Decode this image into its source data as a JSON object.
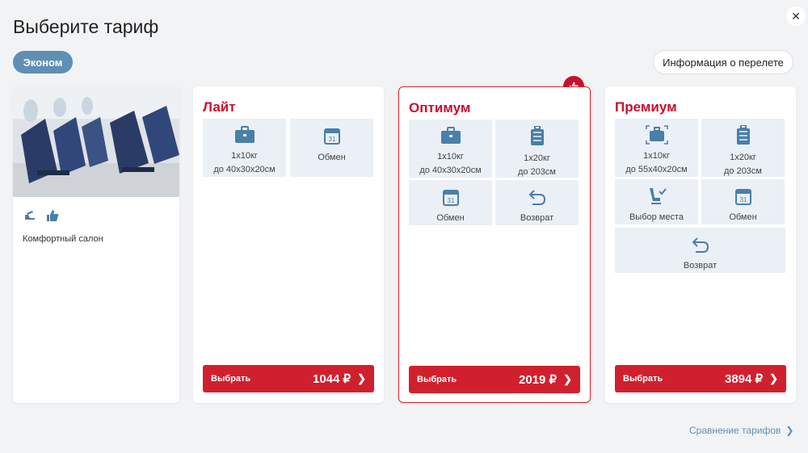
{
  "header": {
    "title": "Выберите тариф",
    "close_glyph": "✕"
  },
  "class_pill": "Эконом",
  "info_button": "Информация о перелете",
  "cabin": {
    "description": "Комфортный салон",
    "icons": [
      "recline-seat-icon",
      "thumbs-up-icon"
    ]
  },
  "tariffs": [
    {
      "name": "Лайт",
      "features": [
        {
          "icon": "briefcase-icon",
          "line1": "1x10кг",
          "line2": "до 40x30x20см"
        },
        {
          "icon": "calendar-icon",
          "line1": "Обмен",
          "line2": ""
        }
      ],
      "buy_label": "Выбрать",
      "price": "1044 ₽"
    },
    {
      "name": "Оптимум",
      "recommended": true,
      "features": [
        {
          "icon": "briefcase-icon",
          "line1": "1x10кг",
          "line2": "до 40x30x20см"
        },
        {
          "icon": "suitcase-icon",
          "line1": "1x20кг",
          "line2": "до 203см"
        },
        {
          "icon": "calendar-icon",
          "line1": "Обмен",
          "line2": ""
        },
        {
          "icon": "return-icon",
          "line1": "Возврат",
          "line2": ""
        }
      ],
      "buy_label": "Выбрать",
      "price": "2019 ₽"
    },
    {
      "name": "Премиум",
      "features": [
        {
          "icon": "briefcase-icon",
          "line1": "1x10кг",
          "line2": "до 55x40x20см"
        },
        {
          "icon": "suitcase-icon",
          "line1": "1x20кг",
          "line2": "до 203см"
        },
        {
          "icon": "seat-select-icon",
          "line1": "Выбор места",
          "line2": ""
        },
        {
          "icon": "calendar-icon",
          "line1": "Обмен",
          "line2": ""
        },
        {
          "icon": "return-icon",
          "line1": "Возврат",
          "line2": ""
        }
      ],
      "buy_label": "Выбрать",
      "price": "3894 ₽"
    }
  ],
  "footer": {
    "compare_link": "Сравнение тарифов"
  },
  "colors": {
    "accent_red": "#c8102e",
    "button_red": "#d0202e",
    "blue": "#5f8fb4",
    "feature_bg": "#eaf0f5"
  }
}
